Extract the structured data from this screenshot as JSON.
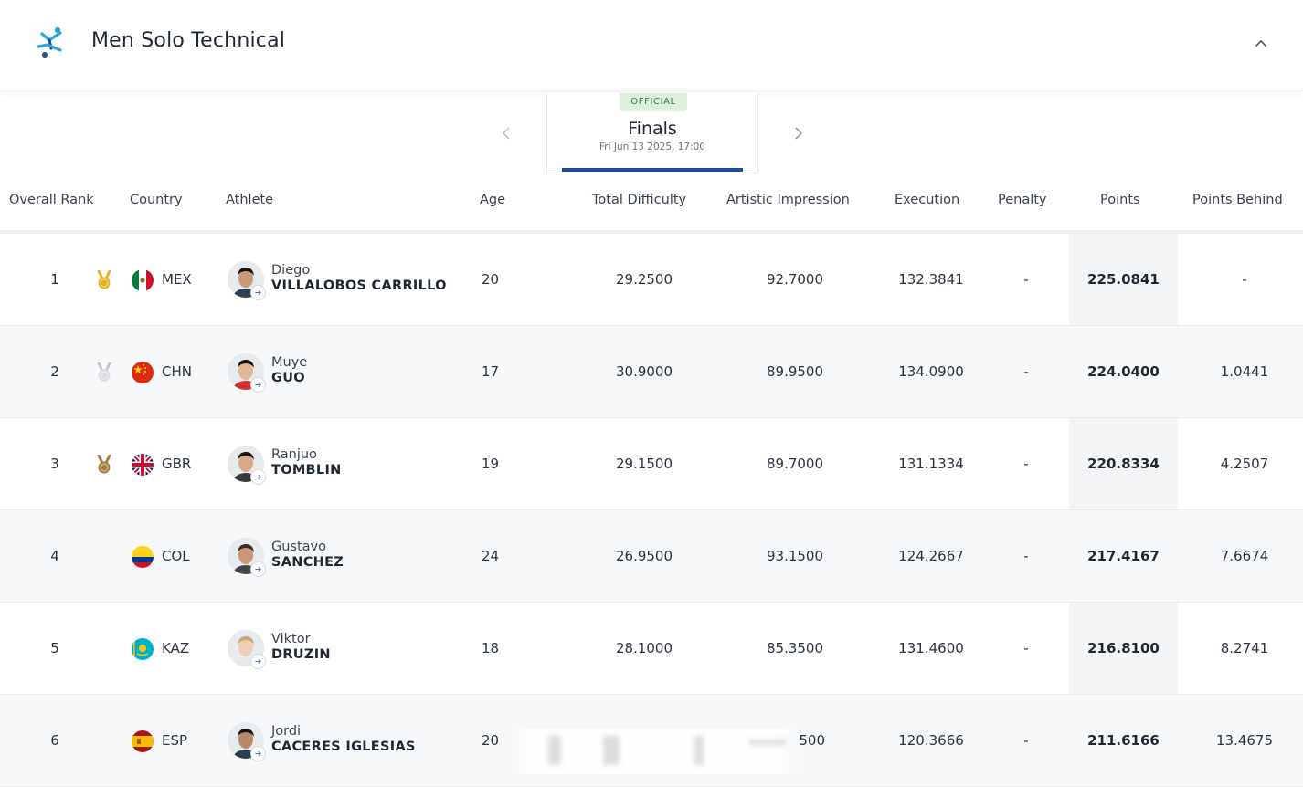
{
  "event": {
    "title": "Men Solo Technical"
  },
  "phase": {
    "badge": "OFFICIAL",
    "name": "Finals",
    "date": "Fri Jun 13 2025, 17:00"
  },
  "columns": {
    "overall_rank": "Overall Rank",
    "country": "Country",
    "athlete": "Athlete",
    "age": "Age",
    "total_difficulty": "Total Difficulty",
    "artistic_impression": "Artistic Impression",
    "execution": "Execution",
    "penalty": "Penalty",
    "points": "Points",
    "points_behind": "Points Behind"
  },
  "rows": [
    {
      "rank": "1",
      "medal": "gold",
      "country": "MEX",
      "first": "Diego",
      "last": "VILLALOBOS CARRILLO",
      "age": "20",
      "td": "29.2500",
      "ai": "92.7000",
      "ex": "132.3841",
      "pen": "-",
      "pts": "225.0841",
      "pb": "-"
    },
    {
      "rank": "2",
      "medal": "silver",
      "country": "CHN",
      "first": "Muye",
      "last": "GUO",
      "age": "17",
      "td": "30.9000",
      "ai": "89.9500",
      "ex": "134.0900",
      "pen": "-",
      "pts": "224.0400",
      "pb": "1.0441"
    },
    {
      "rank": "3",
      "medal": "bronze",
      "country": "GBR",
      "first": "Ranjuo",
      "last": "TOMBLIN",
      "age": "19",
      "td": "29.1500",
      "ai": "89.7000",
      "ex": "131.1334",
      "pen": "-",
      "pts": "220.8334",
      "pb": "4.2507"
    },
    {
      "rank": "4",
      "medal": "",
      "country": "COL",
      "first": "Gustavo",
      "last": "SANCHEZ",
      "age": "24",
      "td": "26.9500",
      "ai": "93.1500",
      "ex": "124.2667",
      "pen": "-",
      "pts": "217.4167",
      "pb": "7.6674"
    },
    {
      "rank": "5",
      "medal": "",
      "country": "KAZ",
      "first": "Viktor",
      "last": "DRUZIN",
      "age": "18",
      "td": "28.1000",
      "ai": "85.3500",
      "ex": "131.4600",
      "pen": "-",
      "pts": "216.8100",
      "pb": "8.2741"
    },
    {
      "rank": "6",
      "medal": "",
      "country": "ESP",
      "first": "Jordi",
      "last": "CACERES IGLESIAS",
      "age": "20",
      "td": "",
      "ai": "500",
      "ex": "120.3666",
      "pen": "-",
      "pts": "211.6166",
      "pb": "13.4675"
    }
  ],
  "colors": {
    "accent": "#1e4e9a",
    "official_bg": "#dcefdc",
    "official_text": "#3a7a44",
    "logo": "#2aa8d8",
    "gold": "#e5b321",
    "silver": "#c5c8cc",
    "bronze": "#a77d3c"
  }
}
